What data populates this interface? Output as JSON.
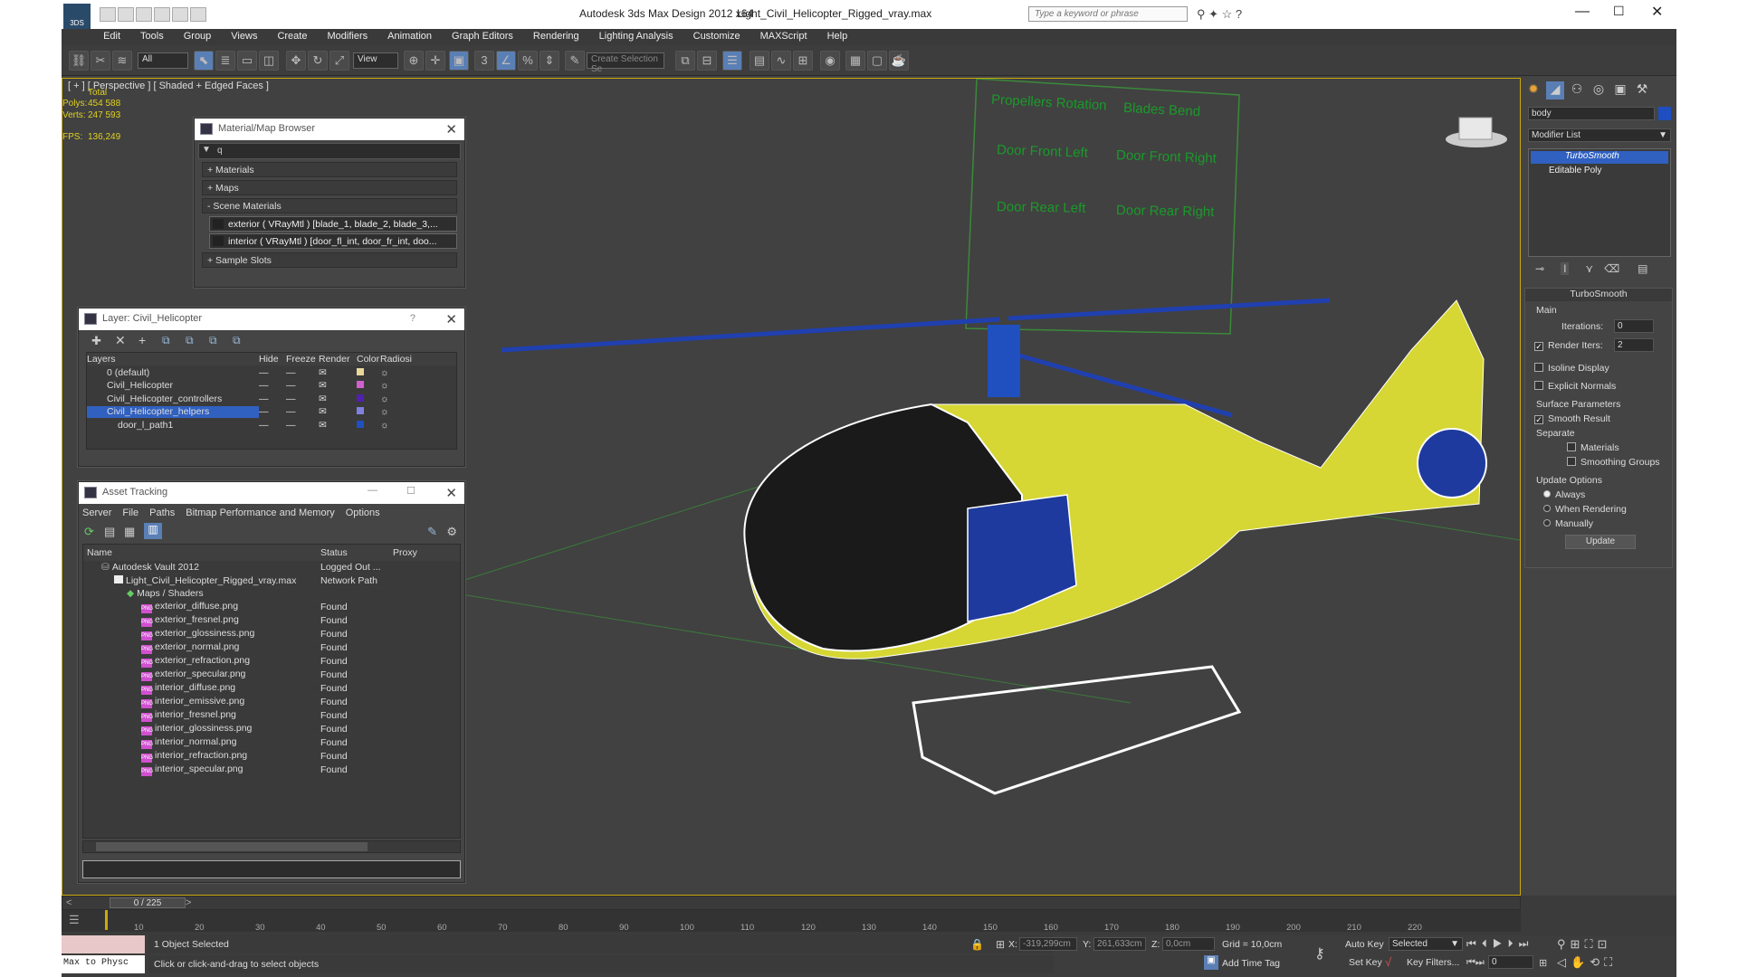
{
  "app": {
    "title": "Autodesk 3ds Max Design 2012 x64",
    "file": "Light_Civil_Helicopter_Rigged_vray.max",
    "search_placeholder": "Type a keyword or phrase",
    "logo": "3DS"
  },
  "menu": [
    "Edit",
    "Tools",
    "Group",
    "Views",
    "Create",
    "Modifiers",
    "Animation",
    "Graph Editors",
    "Rendering",
    "Lighting Analysis",
    "Customize",
    "MAXScript",
    "Help"
  ],
  "toolbar": {
    "filter": "All",
    "refcoord": "View",
    "selection_set_placeholder": "Create Selection Se"
  },
  "viewport": {
    "label": "[ + ] [ Perspective ] [ Shaded + Edged Faces ]",
    "stats": {
      "total": "Total",
      "polys_label": "Polys:",
      "polys": "454 588",
      "verts_label": "Verts:",
      "verts": "247 593",
      "fps_label": "FPS:",
      "fps": "136,249"
    },
    "controls": [
      "Propellers Rotation",
      "Blades Bend",
      "Door Front Left",
      "Door Front Right",
      "Door Rear Left",
      "Door Rear Right"
    ],
    "accent": "#c9a90b"
  },
  "material_browser": {
    "title": "Material/Map Browser",
    "search": "q",
    "sections": [
      "+ Materials",
      "+ Maps",
      "- Scene Materials",
      "+ Sample Slots"
    ],
    "materials": [
      "exterior  ( VRayMtl ) [blade_1, blade_2, blade_3,...",
      "interior  ( VRayMtl ) [door_fl_int, door_fr_int, doo..."
    ]
  },
  "layers": {
    "title": "Layer: Civil_Helicopter",
    "help": "?",
    "columns": [
      "Layers",
      "Hide",
      "Freeze",
      "Render",
      "Color",
      "Radiosi"
    ],
    "rows": [
      {
        "name": "0 (default)",
        "color": "#e8d89a"
      },
      {
        "name": "Civil_Helicopter",
        "color": "#d060d0"
      },
      {
        "name": "Civil_Helicopter_controllers",
        "color": "#5020b0"
      },
      {
        "name": "Civil_Helicopter_helpers",
        "color": "#8080e0"
      },
      {
        "name": "door_l_path1",
        "color": "#2050c0"
      }
    ]
  },
  "assets": {
    "title": "Asset Tracking",
    "menu": [
      "Server",
      "File",
      "Paths",
      "Bitmap Performance and Memory",
      "Options"
    ],
    "columns": [
      "Name",
      "Status",
      "Proxy"
    ],
    "rows": [
      {
        "name": "Autodesk Vault 2012",
        "status": "Logged Out ...",
        "indent": 0
      },
      {
        "name": "Light_Civil_Helicopter_Rigged_vray.max",
        "status": "Network Path",
        "indent": 1
      },
      {
        "name": "Maps / Shaders",
        "status": "",
        "indent": 2
      },
      {
        "name": "exterior_diffuse.png",
        "status": "Found",
        "indent": 3
      },
      {
        "name": "exterior_fresnel.png",
        "status": "Found",
        "indent": 3
      },
      {
        "name": "exterior_glossiness.png",
        "status": "Found",
        "indent": 3
      },
      {
        "name": "exterior_normal.png",
        "status": "Found",
        "indent": 3
      },
      {
        "name": "exterior_refraction.png",
        "status": "Found",
        "indent": 3
      },
      {
        "name": "exterior_specular.png",
        "status": "Found",
        "indent": 3
      },
      {
        "name": "interior_diffuse.png",
        "status": "Found",
        "indent": 3
      },
      {
        "name": "interior_emissive.png",
        "status": "Found",
        "indent": 3
      },
      {
        "name": "interior_fresnel.png",
        "status": "Found",
        "indent": 3
      },
      {
        "name": "interior_glossiness.png",
        "status": "Found",
        "indent": 3
      },
      {
        "name": "interior_normal.png",
        "status": "Found",
        "indent": 3
      },
      {
        "name": "interior_refraction.png",
        "status": "Found",
        "indent": 3
      },
      {
        "name": "interior_specular.png",
        "status": "Found",
        "indent": 3
      }
    ]
  },
  "command_panel": {
    "object_name": "body",
    "modifier_list": "Modifier List",
    "stack": [
      "TurboSmooth",
      "Editable Poly"
    ],
    "turbosmooth": {
      "title": "TurboSmooth",
      "main": "Main",
      "iterations_label": "Iterations:",
      "iterations": "0",
      "render_iters_label": "Render Iters:",
      "render_iters": "2",
      "isoline": "Isoline Display",
      "explicit": "Explicit Normals",
      "surface": "Surface Parameters",
      "smooth_result": "Smooth Result",
      "separate": "Separate",
      "materials": "Materials",
      "smoothing_groups": "Smoothing Groups",
      "update_options": "Update Options",
      "always": "Always",
      "when_rendering": "When Rendering",
      "manually": "Manually",
      "update": "Update"
    }
  },
  "timeline": {
    "frame": "0 / 225",
    "ticks": [
      "10",
      "20",
      "30",
      "40",
      "50",
      "60",
      "70",
      "80",
      "90",
      "100",
      "110",
      "120",
      "130",
      "140",
      "150",
      "160",
      "170",
      "180",
      "190",
      "200",
      "210",
      "220"
    ]
  },
  "status": {
    "selected": "1 Object Selected",
    "prompt": "Click or click-and-drag to select objects",
    "listener": "Max to Physc",
    "x_label": "X:",
    "x": "-319,299cm",
    "y_label": "Y:",
    "y": "261,633cm",
    "z_label": "Z:",
    "z": "0,0cm",
    "grid": "Grid = 10,0cm",
    "auto_key": "Auto Key",
    "selected_dd": "Selected",
    "set_key": "Set Key",
    "key_filters": "Key Filters...",
    "add_time_tag": "Add Time Tag",
    "frame_field": "0"
  }
}
